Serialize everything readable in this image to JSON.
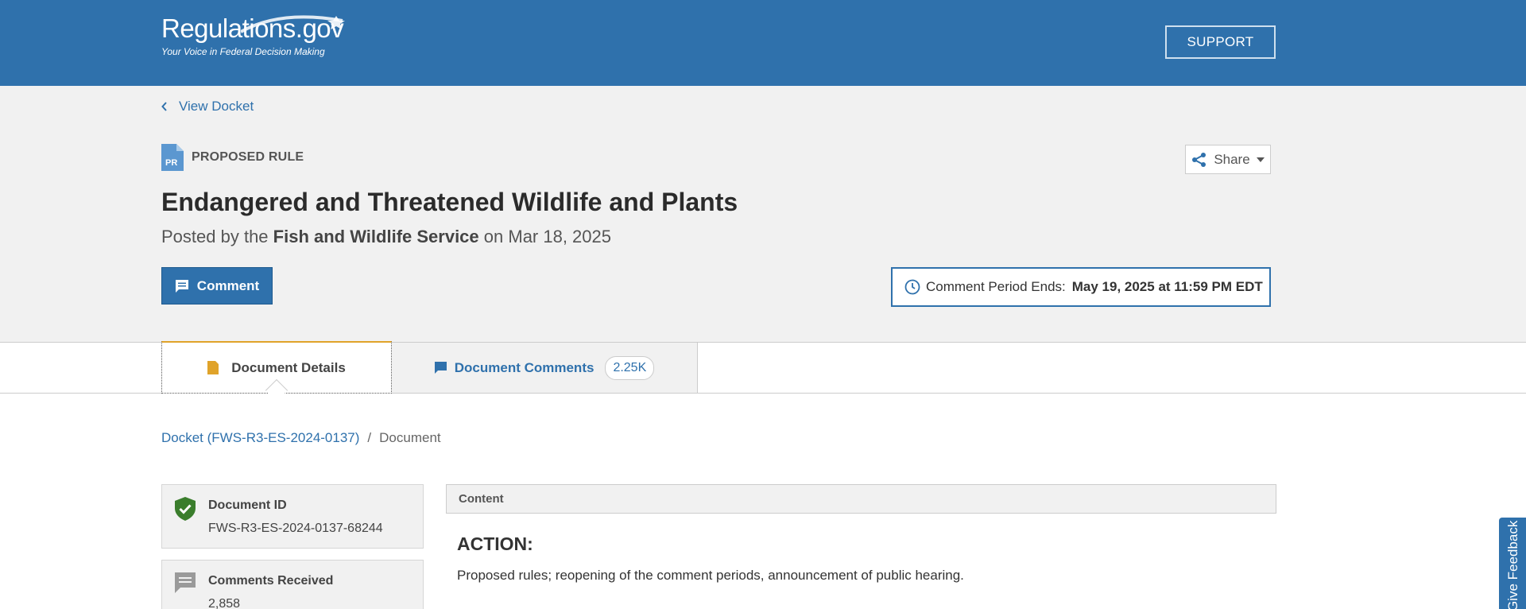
{
  "header": {
    "logo_text": "Regulations.gov",
    "logo_tagline": "Your Voice in Federal Decision Making",
    "support_label": "SUPPORT"
  },
  "hero": {
    "back_label": "View Docket",
    "doc_type_badge": "PR",
    "doc_type_label": "PROPOSED RULE",
    "share_label": "Share",
    "title": "Endangered and Threatened Wildlife and Plants",
    "posted_prefix": "Posted by the",
    "posted_agency": "Fish and Wildlife Service",
    "posted_suffix": "on Mar 18, 2025",
    "comment_label": "Comment",
    "period_label": "Comment Period Ends:",
    "period_value": "May 19, 2025 at 11:59 PM EDT"
  },
  "tabs": {
    "details_label": "Document Details",
    "comments_label": "Document Comments",
    "comments_count": "2.25K"
  },
  "breadcrumb": {
    "docket_link": "Docket (FWS-R3-ES-2024-0137)",
    "separator": "/",
    "current": "Document"
  },
  "sidebar": {
    "doc_id_label": "Document ID",
    "doc_id_value": "FWS-R3-ES-2024-0137-68244",
    "comments_received_label": "Comments Received",
    "comments_received_value": "2,858"
  },
  "content": {
    "header_label": "Content",
    "action_heading": "ACTION:",
    "action_text": "Proposed rules; reopening of the comment periods, announcement of public hearing."
  },
  "feedback_label": "Give Feedback",
  "colors": {
    "brand_blue": "#2f71ac",
    "tab_accent": "#e0a32a",
    "verified_green": "#3a7d2c"
  },
  "icons": {
    "back": "chevron-left-icon",
    "doc_type": "document-pr-icon",
    "share": "share-icon",
    "comment": "comment-bubble-icon",
    "clock": "clock-icon",
    "details_tab": "document-icon",
    "comments_tab": "comment-bubble-icon",
    "verified": "shield-check-icon",
    "comments_received": "comment-bubble-icon"
  }
}
